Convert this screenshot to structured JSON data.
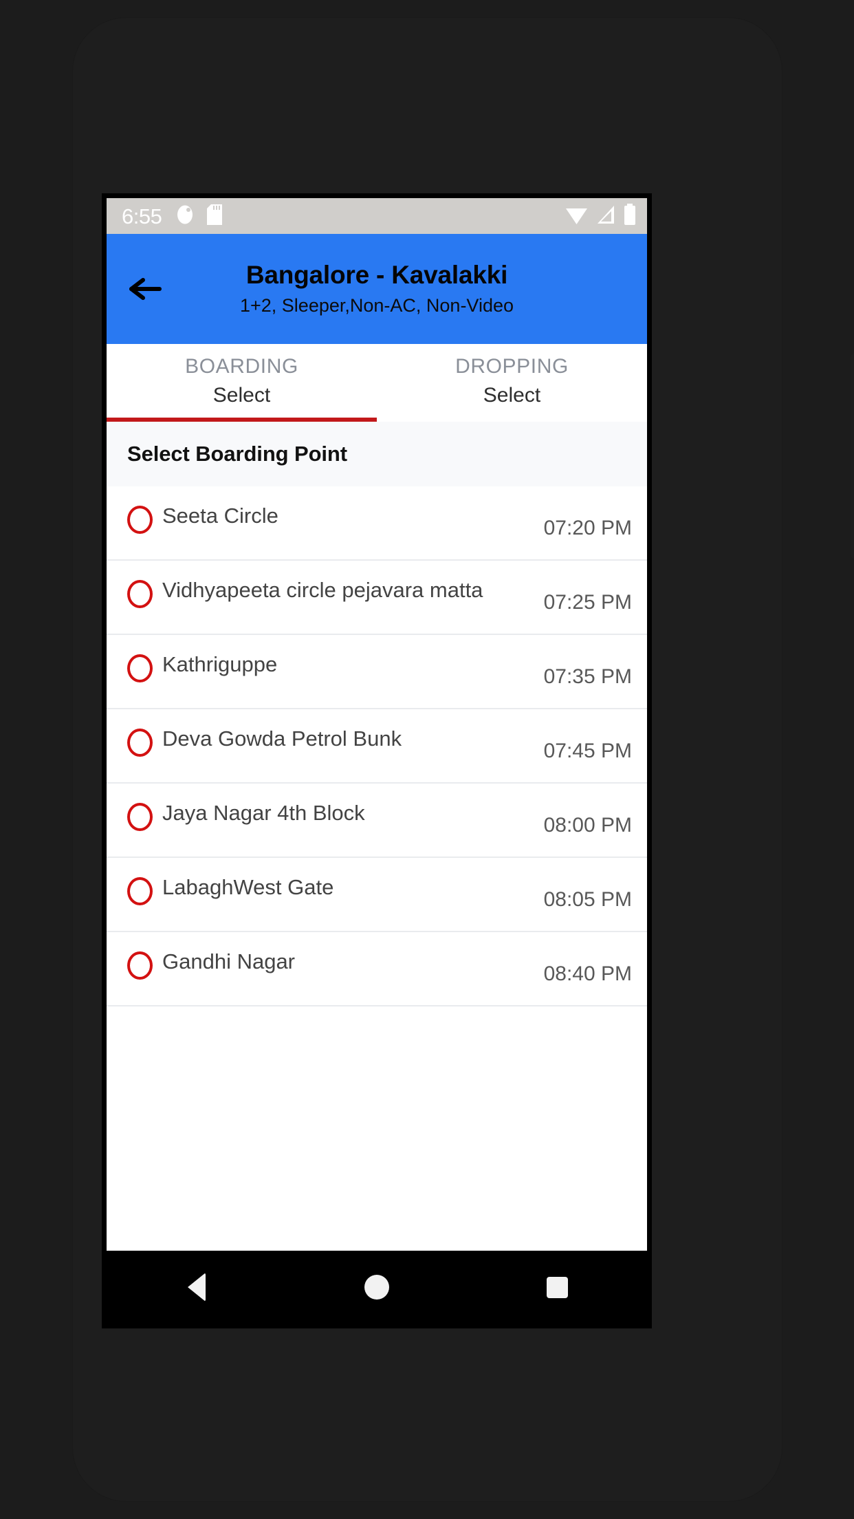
{
  "status_bar": {
    "time": "6:55",
    "left_icons": [
      "notification-dot-icon",
      "sd-card-icon"
    ],
    "right_icons": [
      "wifi-icon",
      "cellular-signal-icon",
      "battery-icon"
    ]
  },
  "app_bar": {
    "back_icon": "back-arrow-icon",
    "title": "Bangalore - Kavalakki",
    "subtitle": "1+2, Sleeper,Non-AC, Non-Video",
    "background_color": "#2979f2",
    "title_color": "#050505"
  },
  "tabs": [
    {
      "label": "BOARDING",
      "value": "Select",
      "active": true
    },
    {
      "label": "DROPPING",
      "value": "Select",
      "active": false
    }
  ],
  "tab_indicator_color": "#c2181a",
  "section": {
    "header": "Select Boarding Point"
  },
  "boarding_points": [
    {
      "name": "Seeta Circle",
      "time": "07:20 PM",
      "selected": false
    },
    {
      "name": "Vidhyapeeta circle pejavara matta",
      "time": "07:25 PM",
      "selected": false
    },
    {
      "name": "Kathriguppe",
      "time": "07:35 PM",
      "selected": false
    },
    {
      "name": "Deva Gowda Petrol Bunk",
      "time": "07:45 PM",
      "selected": false
    },
    {
      "name": "Jaya Nagar 4th Block",
      "time": "08:00 PM",
      "selected": false
    },
    {
      "name": "LabaghWest Gate",
      "time": "08:05 PM",
      "selected": false
    },
    {
      "name": "Gandhi Nagar",
      "time": "08:40 PM",
      "selected": false
    }
  ],
  "radio_color": "#d31111",
  "nav_bar": {
    "buttons": [
      "back-triangle-icon",
      "home-circle-icon",
      "recents-square-icon"
    ]
  }
}
